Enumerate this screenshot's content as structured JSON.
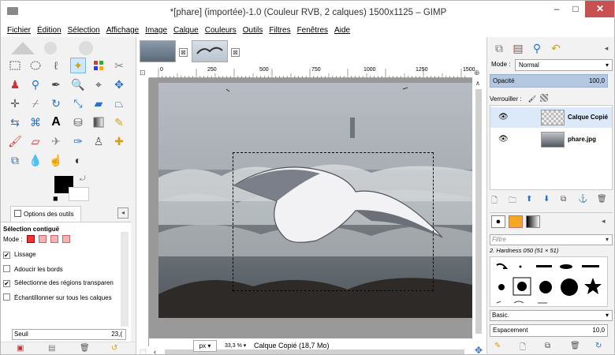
{
  "window": {
    "title": "*[phare] (importée)-1.0 (Couleur RVB, 2 calques) 1500x1125 – GIMP",
    "minimize": "–",
    "maximize": "□",
    "close": "✕"
  },
  "menu": [
    "Fichier",
    "Édition",
    "Sélection",
    "Affichage",
    "Image",
    "Calque",
    "Couleurs",
    "Outils",
    "Filtres",
    "Fenêtres",
    "Aide"
  ],
  "toolbox": {
    "options_tab": "Options des outils",
    "tool_title": "Sélection contiguë",
    "mode_label": "Mode :",
    "options": [
      {
        "label": "Lissage",
        "checked": true
      },
      {
        "label": "Adoucir les bords",
        "checked": false
      },
      {
        "label": "Sélectionne des régions transparen",
        "checked": true
      },
      {
        "label": "Échantillonner sur tous les calques",
        "checked": false
      }
    ],
    "seuil_label": "Seuil",
    "seuil_value": "23,(",
    "icons": [
      "save-icon",
      "restore-icon",
      "delete-icon",
      "reset-icon"
    ]
  },
  "ruler": {
    "ticks": [
      "0",
      "250",
      "500",
      "750",
      "1000",
      "1250",
      "1500"
    ]
  },
  "status": {
    "unit": "px",
    "zoom": "33,3 %",
    "text": "Calque Copié (18,7 Mo)"
  },
  "layers": {
    "mode_label": "Mode :",
    "mode_value": "Normal",
    "opacity_label": "Opacité",
    "opacity_value": "100,0",
    "lock_label": "Verrouiller :",
    "items": [
      {
        "name": "Calque Copié",
        "visible": true,
        "active": true
      },
      {
        "name": "phare.jpg",
        "visible": true,
        "active": false
      }
    ]
  },
  "brushes": {
    "filter_placeholder": "Filtre",
    "brush_name": "2. Hardness 050 (51 × 51)",
    "preset": "Basic.",
    "spacing_label": "Espacement",
    "spacing_value": "10,0"
  }
}
